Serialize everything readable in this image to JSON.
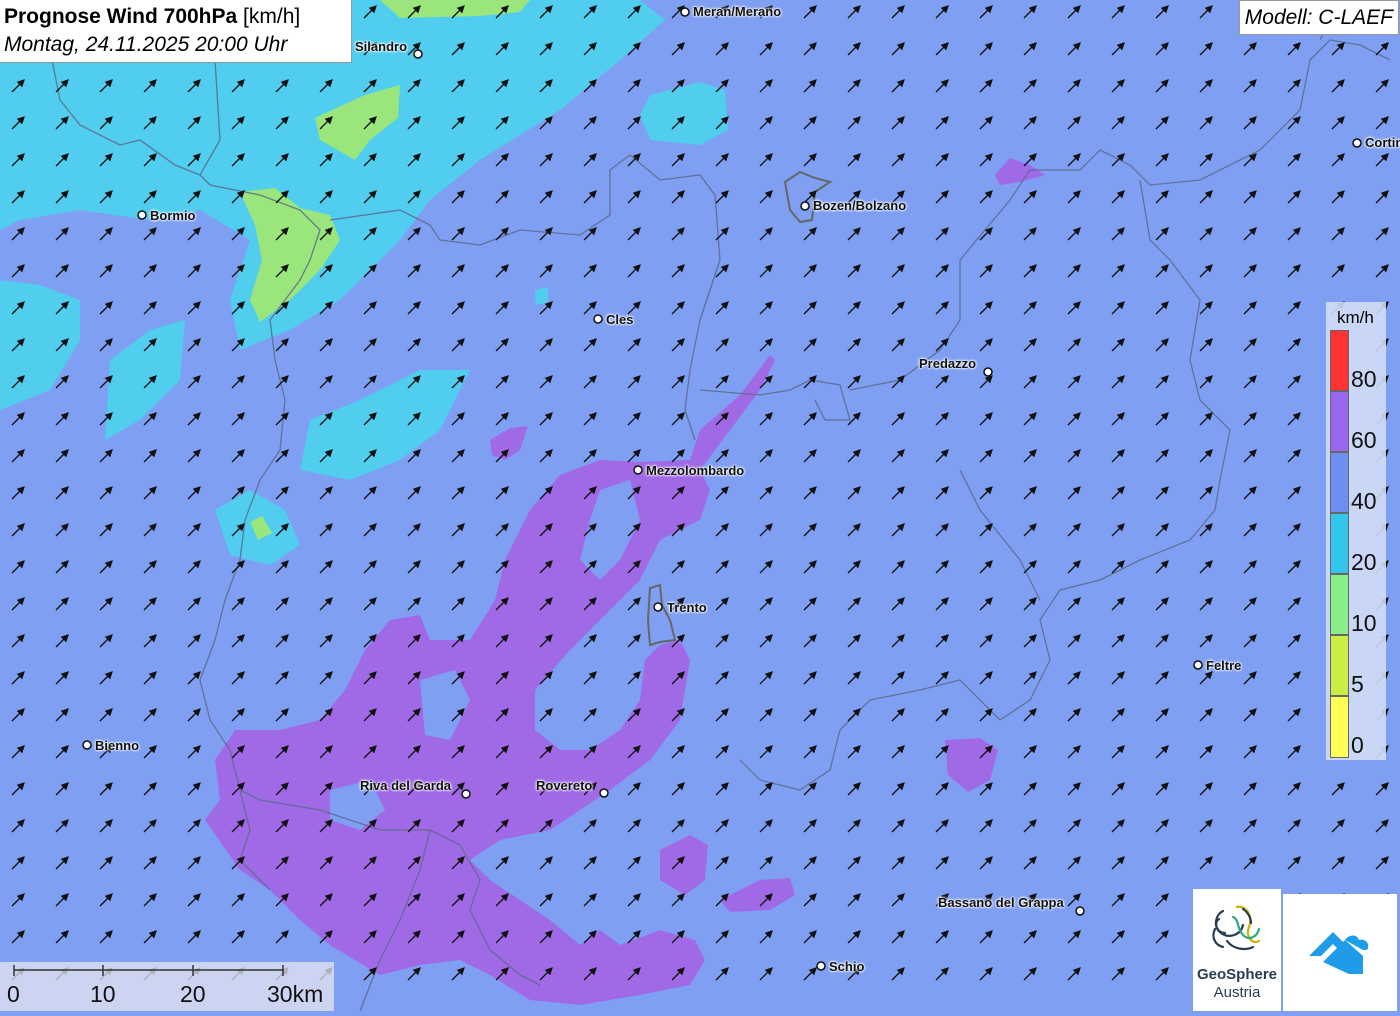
{
  "header": {
    "title_bold": "Prognose Wind 700hPa",
    "title_unit": "[km/h]",
    "datetime": "Montag, 24.11.2025 20:00 Uhr"
  },
  "model_label": "Modell: C-LAEF",
  "cities": [
    {
      "name": "Meran/Merano"
    },
    {
      "name": "Silandro"
    },
    {
      "name": "Bormio"
    },
    {
      "name": "Bozen/Bolzano"
    },
    {
      "name": "Cortina"
    },
    {
      "name": "Cles"
    },
    {
      "name": "Predazzo"
    },
    {
      "name": "Mezzolombardo"
    },
    {
      "name": "Trento"
    },
    {
      "name": "Feltre"
    },
    {
      "name": "Bienno"
    },
    {
      "name": "Riva del Garda"
    },
    {
      "name": "Rovereto"
    },
    {
      "name": "Bassano del Grappa"
    },
    {
      "name": "Schio"
    }
  ],
  "legend": {
    "unit": "km/h",
    "labels": [
      "80",
      "60",
      "40",
      "20",
      "10",
      "5",
      "0"
    ],
    "colors": {
      "above_80": "#ff3333",
      "60_80": "#9966ee",
      "40_60": "#6d8ff0",
      "20_40": "#33c6ea",
      "10_20": "#88ee88",
      "5_10": "#ccee44",
      "0_5": "#ffff55"
    }
  },
  "scale_bar": {
    "labels": [
      "0",
      "10",
      "20",
      "30km"
    ]
  },
  "logos": {
    "geosphere_line1": "GeoSphere",
    "geosphere_line2": "Austria",
    "geosphere_icon": "geosphere-logo-icon",
    "cloud_icon": "cloud-arrow-logo-icon"
  },
  "wind": {
    "direction": "southwest (arrows pointing northeast)"
  },
  "colors": {
    "background_40_60": "#7f9ff2",
    "violet_60_80": "#a06ae6",
    "cyan_20_40": "#4fd0ee",
    "green_10_20": "#9ae67c",
    "yellowgreen": "#c8ee5c"
  }
}
